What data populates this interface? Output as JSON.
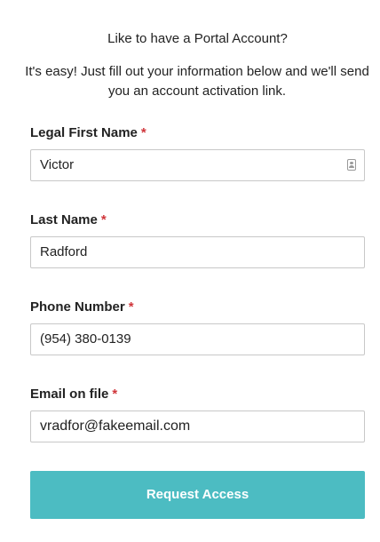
{
  "header": {
    "title": "Like to have a Portal Account?",
    "intro": "It's easy! Just fill out your information below and we'll send you an account activation link."
  },
  "fields": [
    {
      "label": "Legal First Name",
      "required_mark": "*",
      "value": "Victor",
      "icon": "contact-card-icon"
    },
    {
      "label": "Last Name",
      "required_mark": "*",
      "value": "Radford"
    },
    {
      "label": "Phone Number",
      "required_mark": "*",
      "value": "(954) 380-0139"
    },
    {
      "label": "Email on file",
      "required_mark": "*",
      "value": "vradfor@fakeemail.com"
    }
  ],
  "submit": {
    "label": "Request Access"
  },
  "colors": {
    "accent": "#4cbcc2",
    "required": "#d0363b",
    "border": "#c8c8c8"
  }
}
